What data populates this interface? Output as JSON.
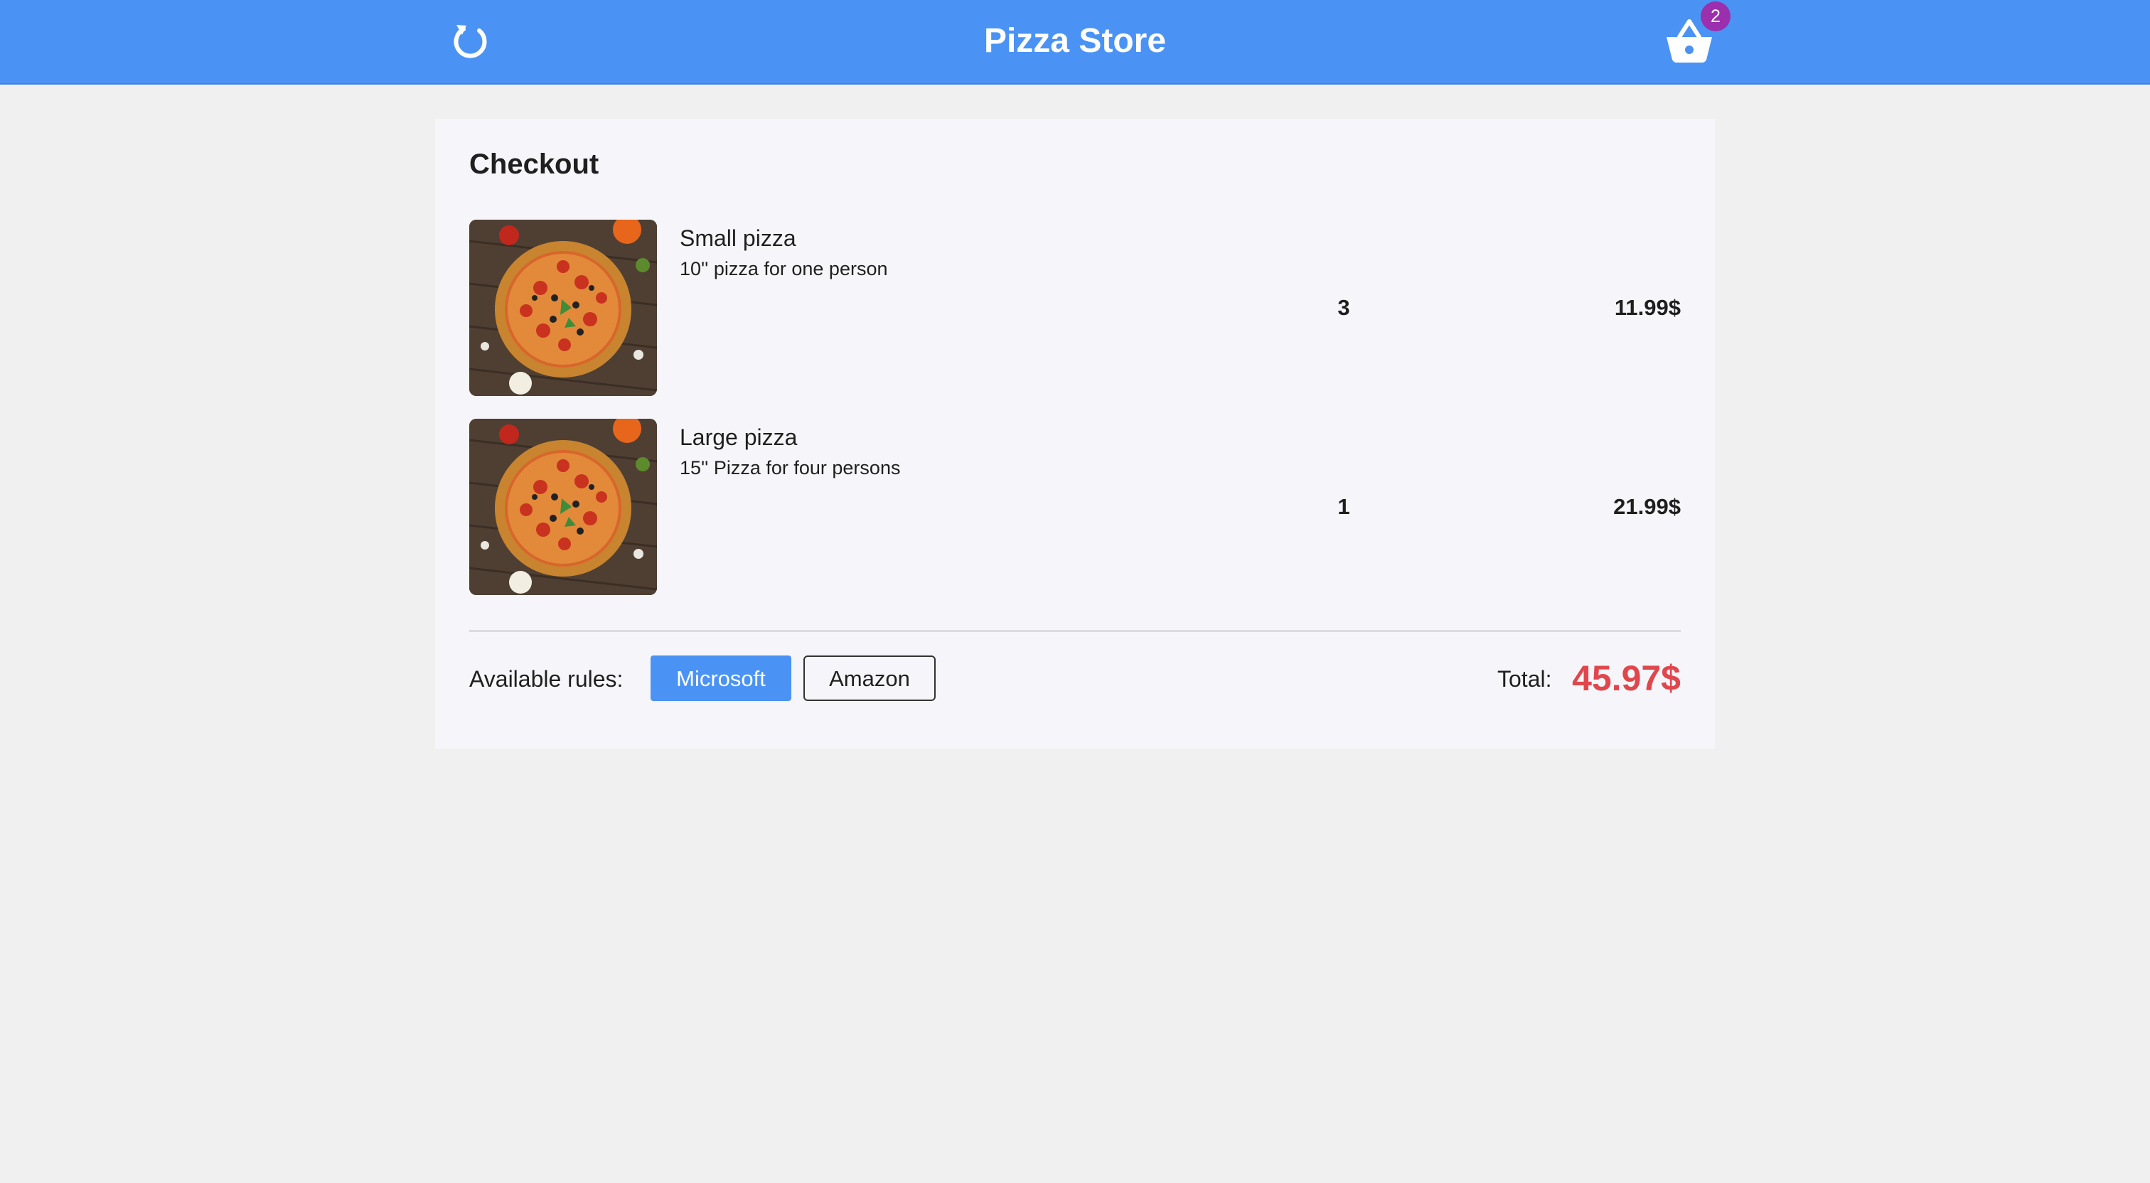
{
  "header": {
    "title": "Pizza Store",
    "refresh_icon": "refresh-icon",
    "cart_icon": "basket-icon",
    "cart_count": "2",
    "bg_color": "#4a93f5",
    "badge_color": "#9b2fae"
  },
  "checkout": {
    "title": "Checkout",
    "items": [
      {
        "name": "Small pizza",
        "description": "10'' pizza for one person",
        "quantity": "3",
        "price": "11.99$",
        "image": "pizza-photo"
      },
      {
        "name": "Large pizza",
        "description": "15'' Pizza for four persons",
        "quantity": "1",
        "price": "21.99$",
        "image": "pizza-photo"
      }
    ],
    "rules_label": "Available rules:",
    "rules": [
      {
        "label": "Microsoft",
        "selected": true
      },
      {
        "label": "Amazon",
        "selected": false
      }
    ],
    "total_label": "Total:",
    "total_value": "45.97$",
    "total_color": "#e0474c"
  }
}
